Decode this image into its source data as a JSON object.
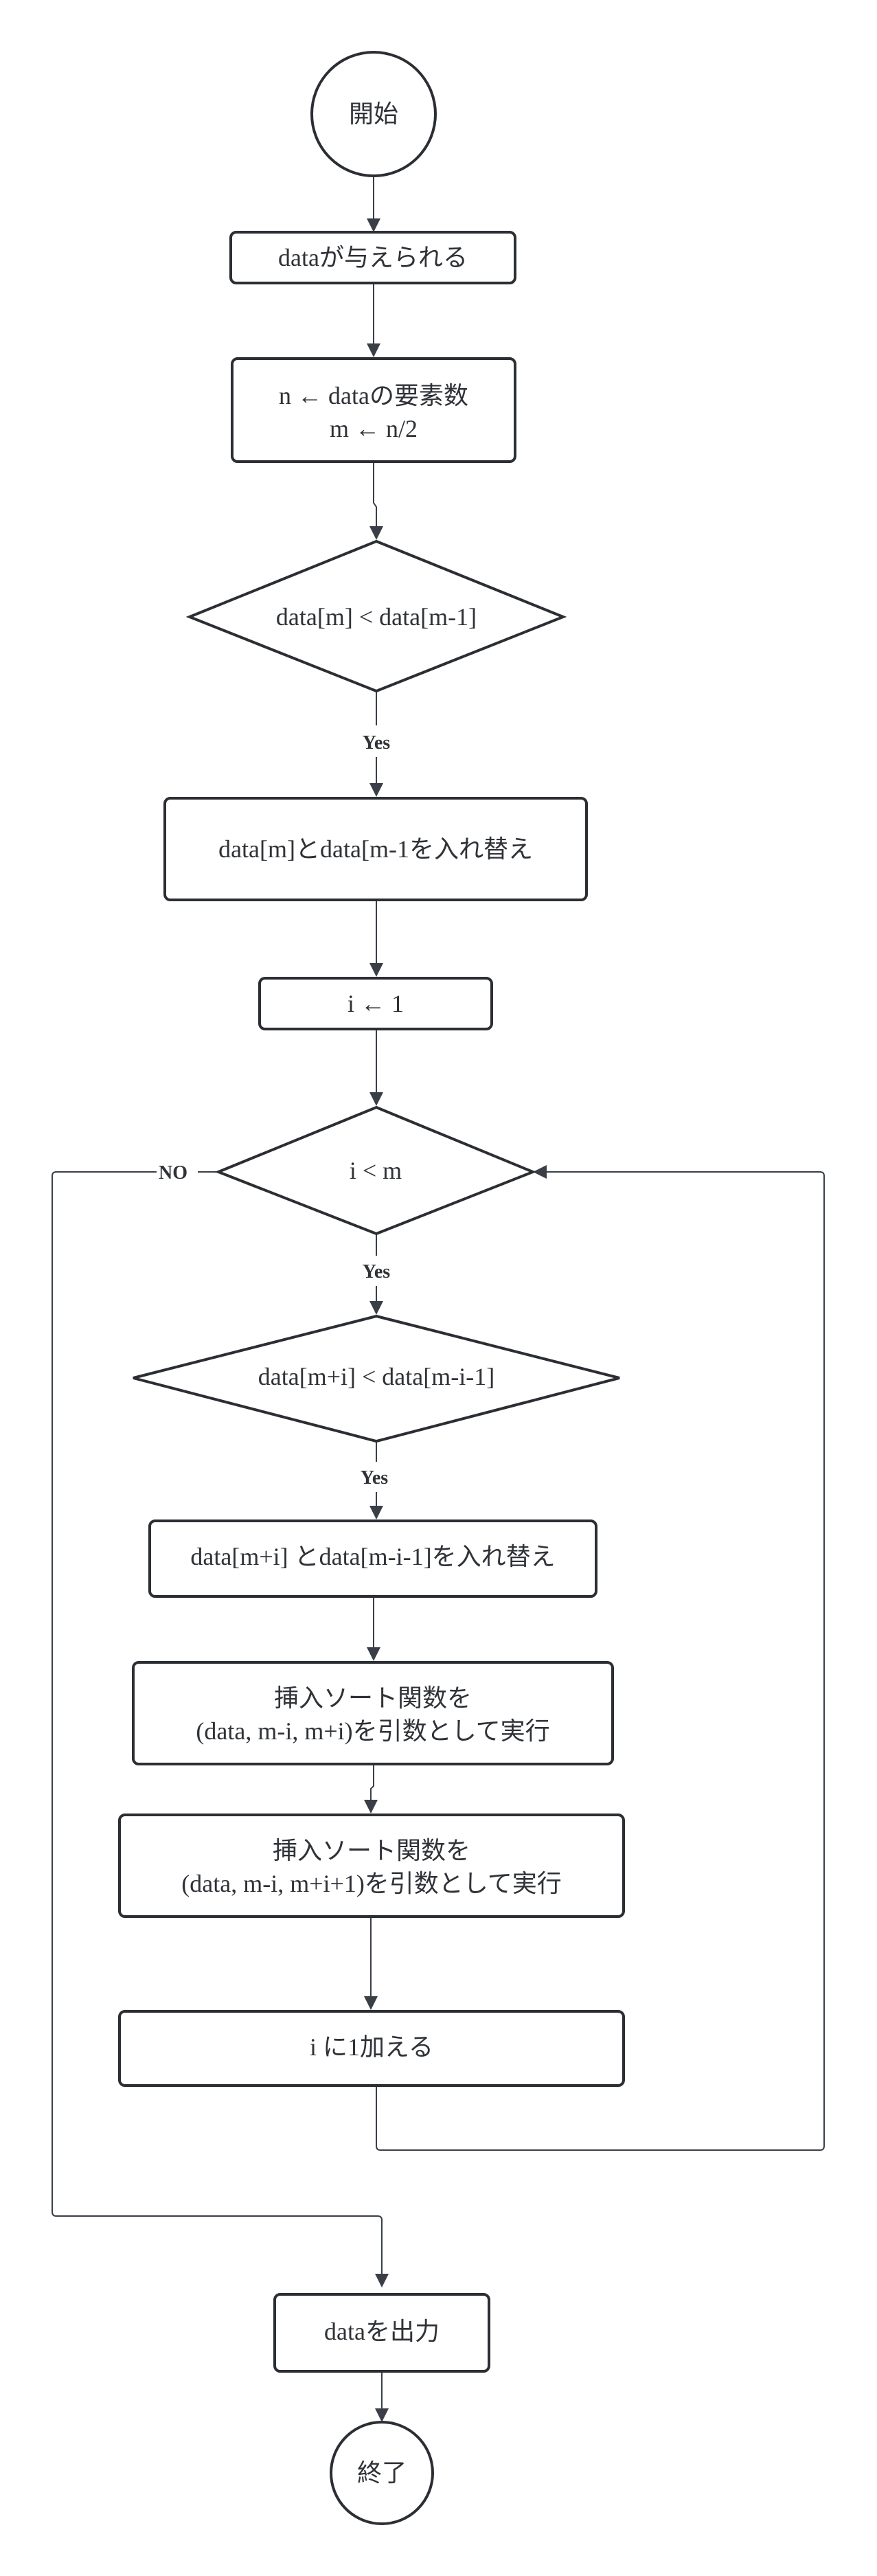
{
  "nodes": {
    "start": "開始",
    "given": "dataが与えられる",
    "init_line1": "n ← dataの要素数",
    "init_line2": "m ← n/2",
    "cond1": "data[m] < data[m-1]",
    "swap1": "data[m]とdata[m-1を入れ替え",
    "init_i": "i ← 1",
    "cond_loop": "i < m",
    "cond2": "data[m+i] < data[m-i-1]",
    "swap2": "data[m+i] とdata[m-i-1]を入れ替え",
    "call1_line1": "挿入ソート関数を",
    "call1_line2": "(data, m-i, m+i)を引数として実行",
    "call2_line1": "挿入ソート関数を",
    "call2_line2": "(data, m-i, m+i+1)を引数として実行",
    "increment": "i に1加える",
    "output": "dataを出力",
    "end": "終了"
  },
  "edge_labels": {
    "yes1": "Yes",
    "yes2": "Yes",
    "yes3": "Yes",
    "no": "NO"
  },
  "colors": {
    "stroke": "#2b2e33",
    "text": "#2f3237",
    "background": "#ffffff"
  }
}
